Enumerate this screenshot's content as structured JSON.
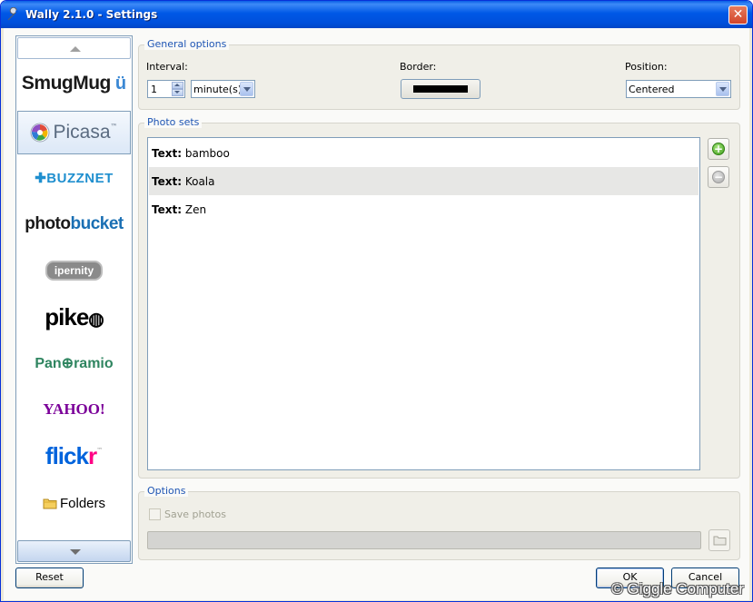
{
  "window": {
    "title": "Wally 2.1.0 - Settings",
    "close_glyph": "✕"
  },
  "sidebar": {
    "services": [
      {
        "name": "SmugMug",
        "icon": "smugmug-logo"
      },
      {
        "name": "Picasa",
        "icon": "picasa-logo",
        "selected": true
      },
      {
        "name": "BUZZNET",
        "icon": "buzznet-logo"
      },
      {
        "name": "photobucket",
        "icon": "photobucket-logo"
      },
      {
        "name": "ipernity",
        "icon": "ipernity-logo"
      },
      {
        "name": "pikeo",
        "icon": "pikeo-logo"
      },
      {
        "name": "Panoramio",
        "icon": "panoramio-logo"
      },
      {
        "name": "YAHOO!",
        "icon": "yahoo-logo"
      },
      {
        "name": "flickr",
        "icon": "flickr-logo"
      },
      {
        "name": "Folders",
        "icon": "folder-icon"
      }
    ],
    "picasa_tm": "™",
    "flickr_tm": "™",
    "smugmug_smile": "ü",
    "photobucket_part1": "photo",
    "photobucket_part2": "bucket",
    "flickr_part1": "flick",
    "flickr_part2": "r",
    "buzznet_text": "✚BUZZNET",
    "pikeo_text": "pike",
    "pikeo_ball": "◍",
    "panoramio_text": "Pan",
    "panoramio_o": "⊕",
    "panoramio_rest": "ramio"
  },
  "general_options": {
    "label": "General options",
    "interval_label": "Interval:",
    "interval_value": "1",
    "interval_unit": "minute(s)",
    "border_label": "Border:",
    "border_color": "#000000",
    "position_label": "Position:",
    "position_value": "Centered"
  },
  "photo_sets": {
    "label": "Photo sets",
    "items": [
      {
        "prefix": "Text:",
        "value": "bamboo"
      },
      {
        "prefix": "Text:",
        "value": "Koala",
        "selected": true
      },
      {
        "prefix": "Text:",
        "value": "Zen"
      }
    ],
    "add_glyph": "+",
    "remove_glyph": "−"
  },
  "options": {
    "label": "Options",
    "save_photos_label": "Save photos",
    "save_photos_checked": false,
    "save_path": ""
  },
  "buttons": {
    "reset": "Reset",
    "ok": "OK",
    "cancel": "Cancel"
  },
  "watermark": "© Giggle Computer",
  "colors": {
    "title_bar": "#0058e6",
    "group_label": "#1e55b4",
    "selected_row": "#e7e7e5"
  }
}
